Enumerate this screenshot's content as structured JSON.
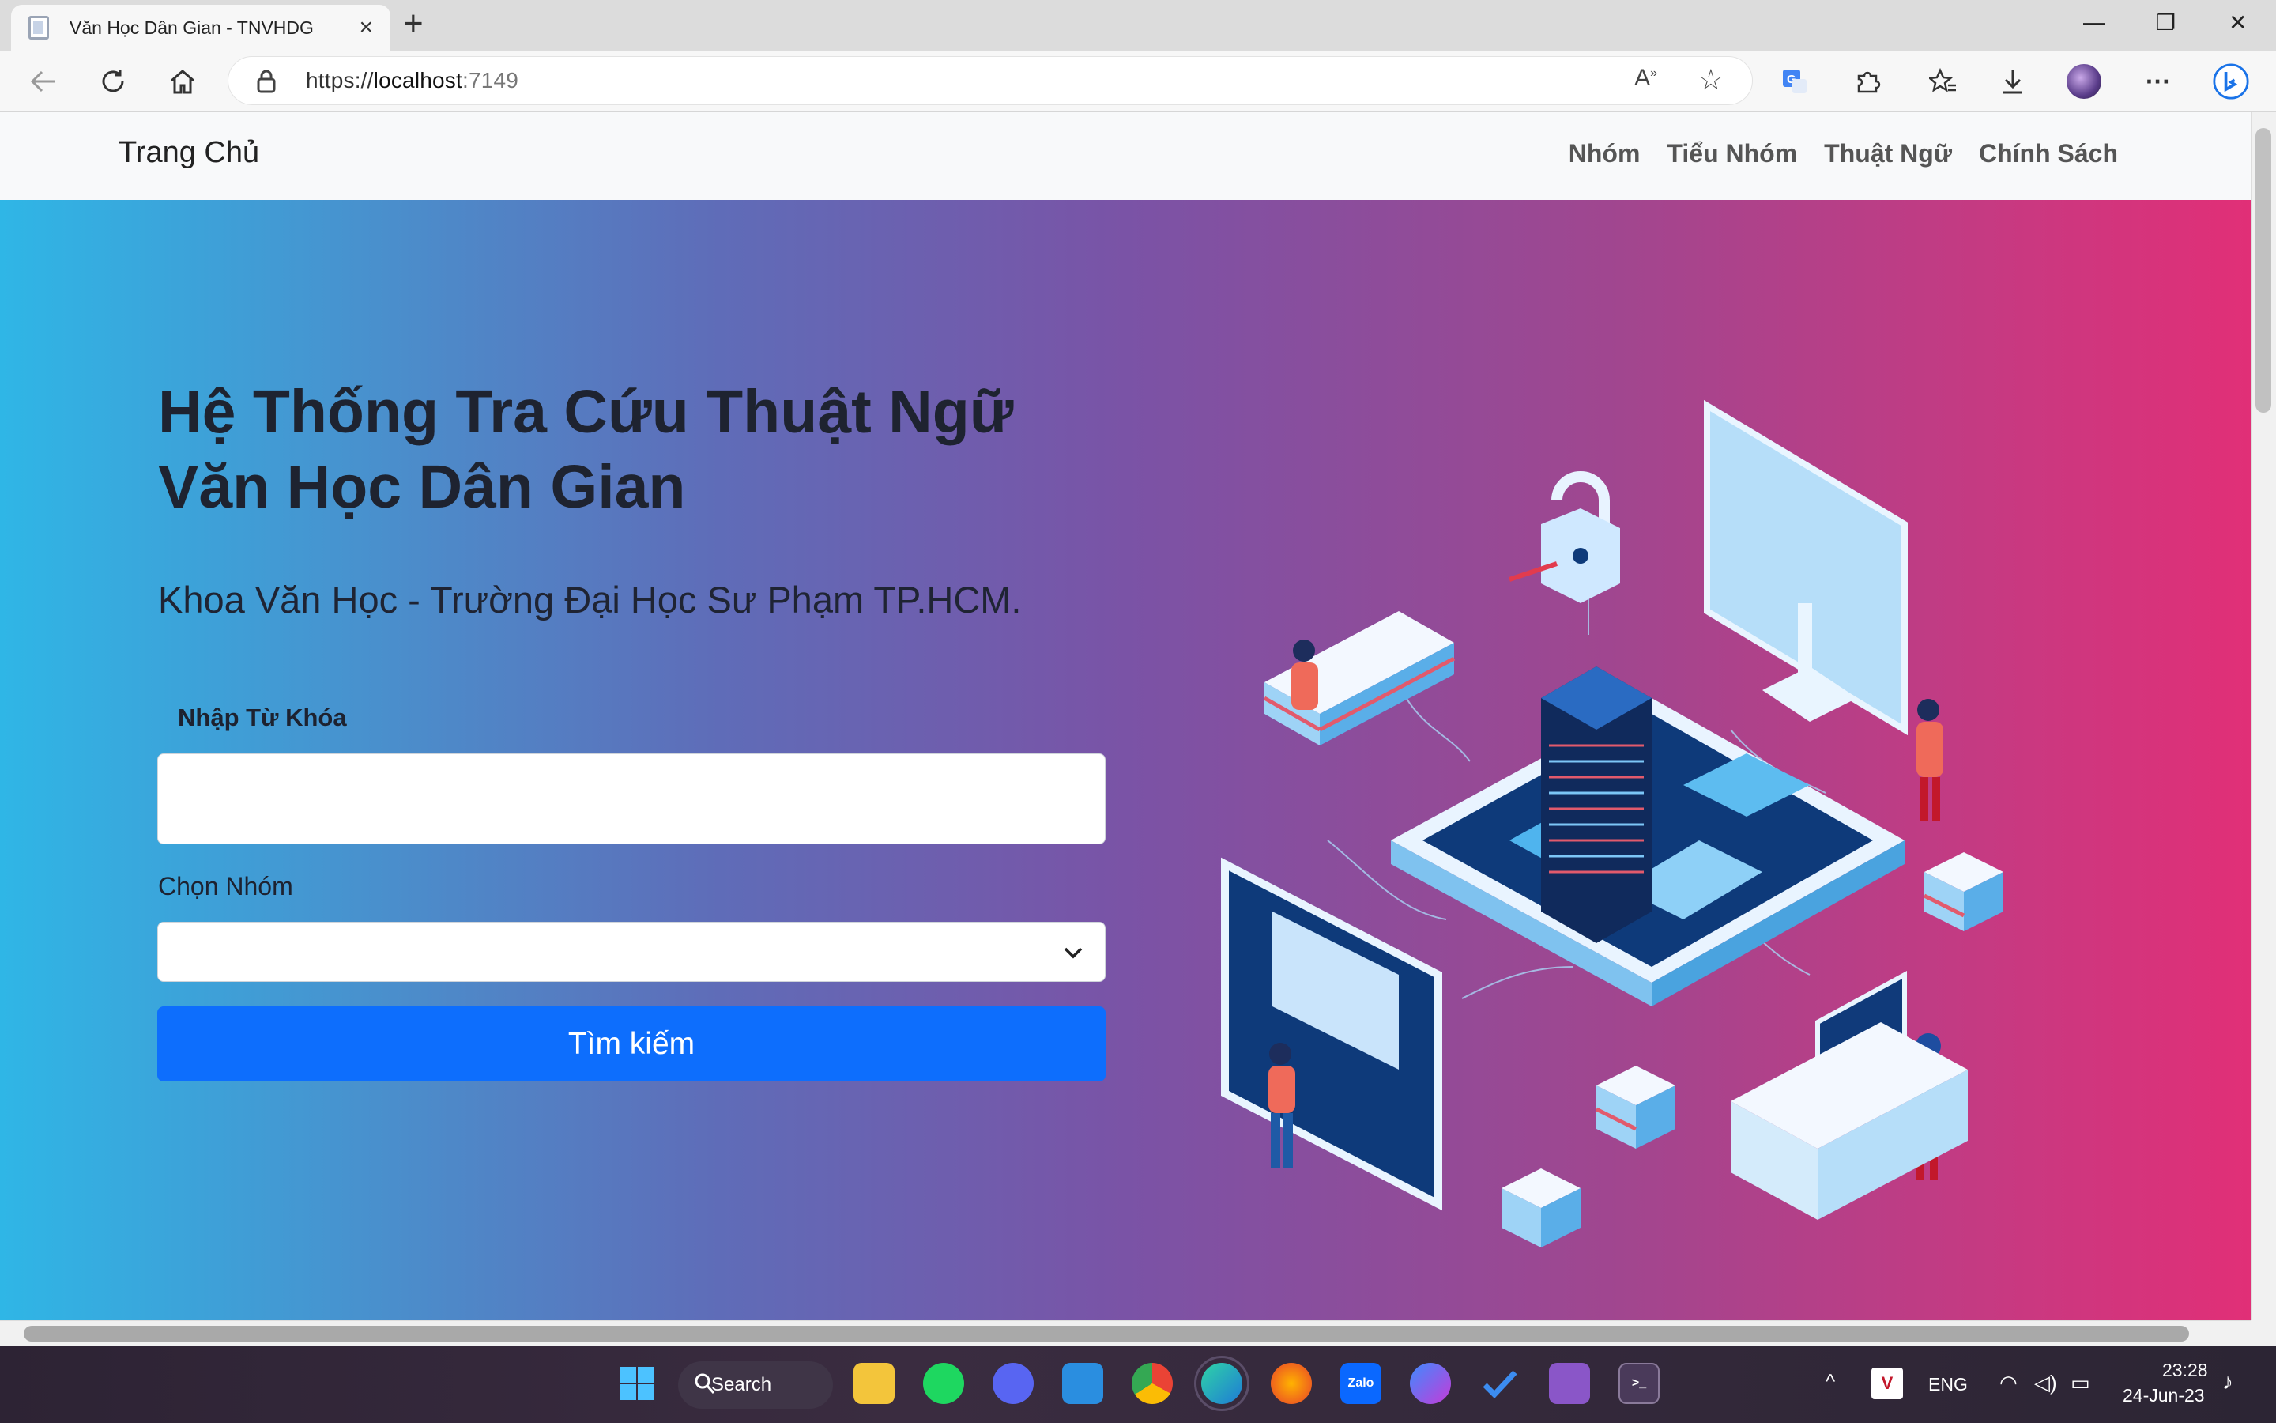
{
  "browser": {
    "tab_title": "Văn Học Dân Gian - TNVHDG",
    "url_scheme": "https://",
    "url_host": "localhost",
    "url_port": ":7149"
  },
  "nav": {
    "brand": "Trang Chủ",
    "links": [
      "Nhóm",
      "Tiểu Nhóm",
      "Thuật Ngữ",
      "Chính Sách"
    ]
  },
  "hero": {
    "title_line1": "Hệ Thống Tra Cứu Thuật Ngữ",
    "title_line2": "Văn Học Dân Gian",
    "subtitle": "Khoa Văn Học - Trường Đại Học Sư Phạm TP.HCM.",
    "keyword_label": "Nhập Từ Khóa",
    "keyword_value": "",
    "group_label": "Chọn Nhóm",
    "group_selected": "",
    "search_button": "Tìm kiếm"
  },
  "taskbar": {
    "search_label": "Search",
    "language": "ENG",
    "time": "23:28",
    "date": "24-Jun-23",
    "apps": [
      "windows-start",
      "file-explorer",
      "spotify",
      "discord",
      "vscode",
      "chrome",
      "edge",
      "firefox",
      "zalo",
      "messenger",
      "todo",
      "visual-studio",
      "terminal"
    ]
  },
  "colors": {
    "gradient_start": "#2fb6e6",
    "gradient_end": "#e12f77",
    "primary_button": "#0d6efd",
    "title_text": "#1e2330"
  }
}
